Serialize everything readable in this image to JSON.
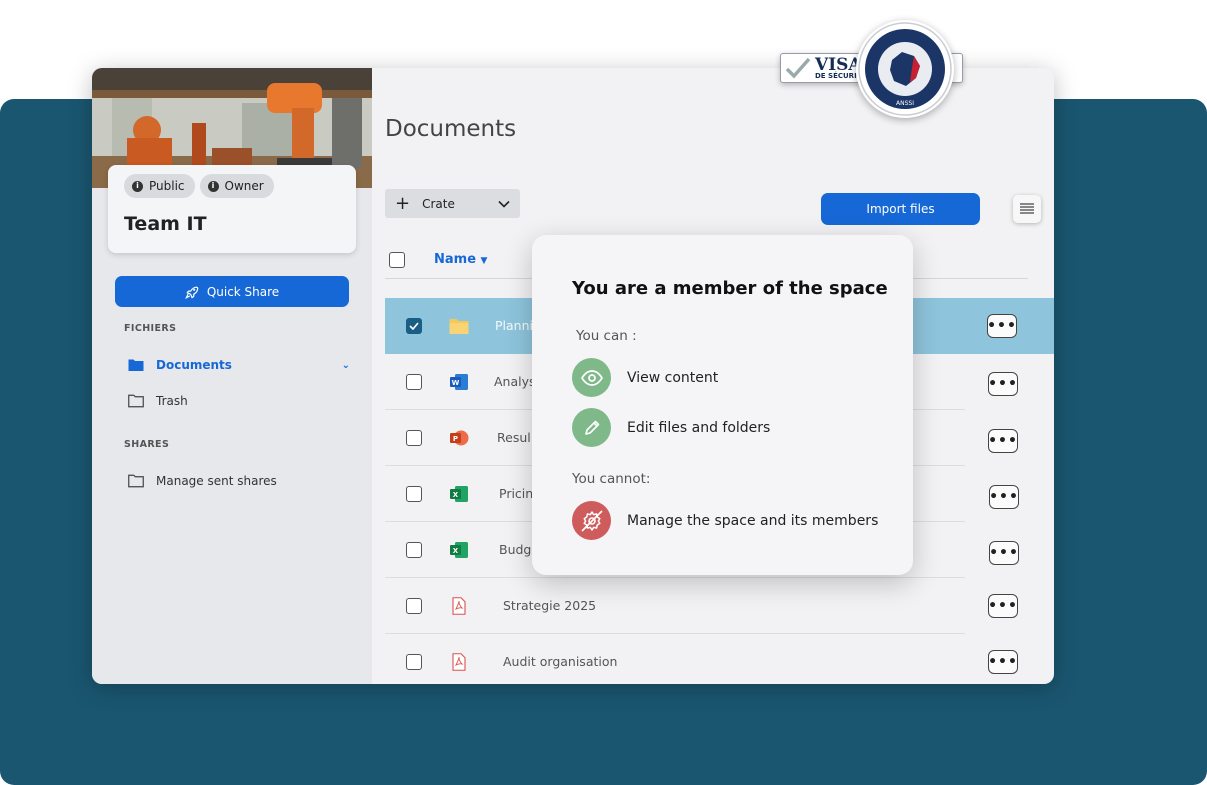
{
  "sidebar": {
    "badges": [
      "Public",
      "Owner"
    ],
    "space_title": "Team IT",
    "quick_share_label": "Quick Share",
    "sections": {
      "files_label": "FICHIERS",
      "shares_label": "SHARES"
    },
    "items": [
      {
        "label": "Documents",
        "active": true
      },
      {
        "label": "Trash",
        "active": false
      },
      {
        "label": "Manage sent shares",
        "active": false
      }
    ]
  },
  "main": {
    "title": "Documents",
    "create_label": "Crate",
    "import_label": "Import files",
    "name_column": "Name",
    "rows": [
      {
        "name": "Planni",
        "type": "folder",
        "selected": true
      },
      {
        "name": "Analys",
        "type": "word",
        "selected": false
      },
      {
        "name": "Resul",
        "type": "powerpoint",
        "selected": false
      },
      {
        "name": "Pricin",
        "type": "excel",
        "selected": false
      },
      {
        "name": "Budg",
        "type": "excel",
        "selected": false
      },
      {
        "name": "Strategie 2025",
        "type": "pdf",
        "selected": false
      },
      {
        "name": "Audit organisation",
        "type": "pdf",
        "selected": false
      }
    ]
  },
  "popover": {
    "title": "You are a member of the space",
    "can_label": "You can :",
    "can": [
      "View content",
      "Edit files and folders"
    ],
    "cannot_label": "You cannot:",
    "cannot": [
      "Manage the space and its members"
    ]
  },
  "visa": {
    "word": "VISA",
    "sub": "DE SÉCURITÉ",
    "seal_text": "ANSSI"
  },
  "colors": {
    "accent": "#1668d6",
    "background_panel": "#1a5670",
    "selected_row": "#8ec5dc",
    "permission_ok": "#7fb98a",
    "permission_denied": "#cf5c5c"
  }
}
